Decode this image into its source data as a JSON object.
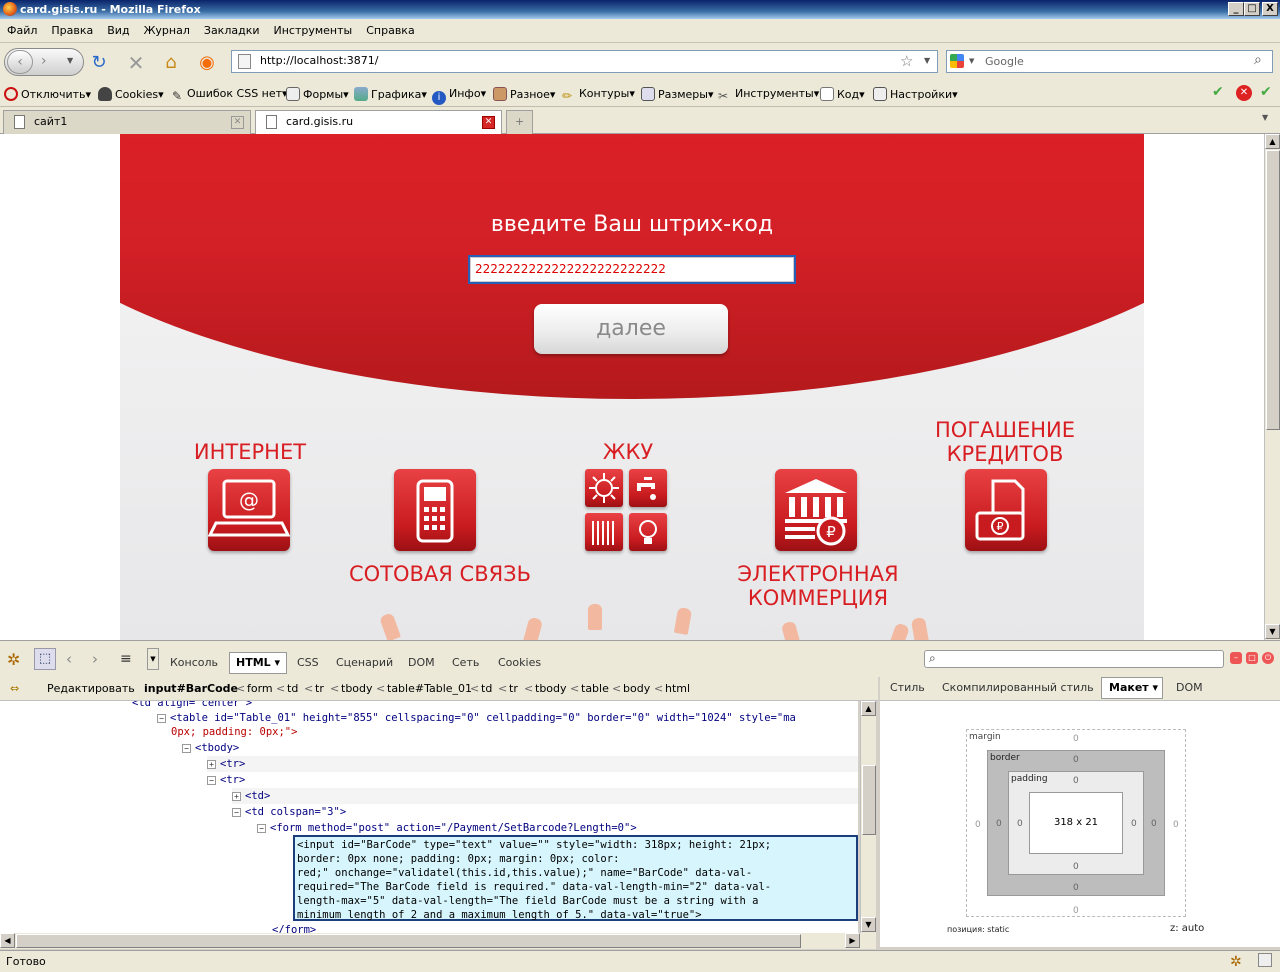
{
  "window": {
    "title": "card.gisis.ru - Mozilla Firefox",
    "minimize": "_",
    "maximize": "□",
    "close": "X"
  },
  "menu": [
    "Файл",
    "Правка",
    "Вид",
    "Журнал",
    "Закладки",
    "Инструменты",
    "Справка"
  ],
  "nav": {
    "url": "http://localhost:3871/",
    "search_placeholder": "Google"
  },
  "devtoolbar": [
    "Отключить",
    "Cookies",
    "Ошибок CSS нет",
    "Формы",
    "Графика",
    "Инфо",
    "Разное",
    "Контуры",
    "Размеры",
    "Инструменты",
    "Код",
    "Настройки"
  ],
  "tabs": [
    {
      "label": "сайт1"
    },
    {
      "label": "card.gisis.ru"
    }
  ],
  "new_tab": "+",
  "page": {
    "prompt": "введите Ваш штрих-код",
    "barcode_value": "2222222222222222222222222",
    "next_label": "далее",
    "categories": {
      "internet": "ИНТЕРНЕТ",
      "mobile": "СОТОВАЯ СВЯЗЬ",
      "housing": "ЖКУ",
      "ecommerce": "ЭЛЕКТРОННАЯ КОММЕРЦИЯ",
      "credits": "ПОГАШЕНИЕ КРЕДИТОВ"
    }
  },
  "firebug": {
    "tabs": {
      "console": "Консоль",
      "html": "HTML",
      "css": "CSS",
      "script": "Сценарий",
      "dom": "DOM",
      "net": "Сеть",
      "cookies": "Cookies"
    },
    "edit": "Редактировать",
    "path": [
      "input#BarCode",
      "form",
      "td",
      "tr",
      "tbody",
      "table#Table_01",
      "td",
      "tr",
      "tbody",
      "table",
      "body",
      "html"
    ],
    "side_tabs": {
      "style": "Стиль",
      "computed": "Скомпилированный стиль",
      "layout": "Макет",
      "dom": "DOM"
    },
    "html_lines": {
      "l0": "<td align=\"center\">",
      "l1": "<table id=\"Table_01\" height=\"855\" cellspacing=\"0\" cellpadding=\"0\" border=\"0\" width=\"1024\" style=\"ma",
      "l1b": "0px; padding: 0px;\">",
      "l2": "<tbody>",
      "l3": "<tr>",
      "l4": "<tr>",
      "l5": "<td>",
      "l6": "<td colspan=\"3\">",
      "l7": "<form method=\"post\" action=\"/Payment/SetBarcode?Length=0\">",
      "sel": "<input id=\"BarCode\" type=\"text\" value=\"\" style=\"width: 318px; height: 21px;\nborder: 0px none; padding: 0px; margin: 0px; color:\nred;\" onchange=\"validatel(this.id,this.value);\" name=\"BarCode\" data-val-\nrequired=\"The BarCode field is required.\" data-val-length-min=\"2\" data-val-\nlength-max=\"5\" data-val-length=\"The field BarCode must be a string with a\nminimum length of 2 and a maximum length of 5.\" data-val=\"true\">",
      "l8": "</form>"
    },
    "layout": {
      "margin": "margin",
      "border": "border",
      "padding": "padding",
      "size": "318 x 21",
      "zero": "0",
      "position": "позиция: static",
      "z": "z: auto"
    }
  },
  "status": "Готово"
}
